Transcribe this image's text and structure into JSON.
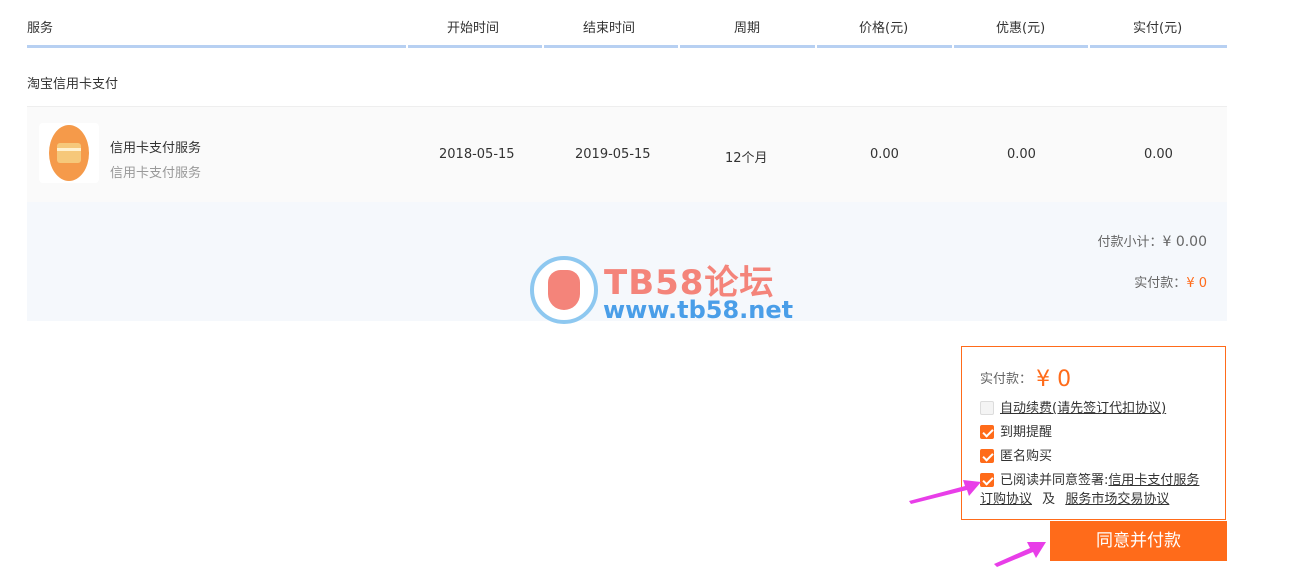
{
  "table": {
    "headers": {
      "service": "服务",
      "start": "开始时间",
      "end": "结束时间",
      "period": "周期",
      "price": "价格(元)",
      "discount": "优惠(元)",
      "paid": "实付(元)"
    },
    "section_title": "淘宝信用卡支付",
    "row": {
      "name": "信用卡支付服务",
      "subtitle": "信用卡支付服务",
      "start": "2018-05-15",
      "end": "2019-05-15",
      "period": "12个月",
      "price": "0.00",
      "discount": "0.00",
      "paid": "0.00"
    }
  },
  "summary": {
    "subtotal_label": "付款小计：",
    "subtotal_value": "¥ 0.00",
    "paid_label": "实付款：",
    "paid_value": "¥ 0"
  },
  "watermark": {
    "title": "TB58论坛",
    "url": "www.tb58.net"
  },
  "payment": {
    "total_label": "实付款：",
    "total_value": "¥ 0",
    "options": {
      "auto_renew": "自动续费(请先签订代扣协议)",
      "expiry_reminder": "到期提醒",
      "anonymous": "匿名购买",
      "agree_prefix": "已阅读并同意签署:",
      "agreement1_part1": "信用卡支付服务",
      "agreement1_part2": "订购协议",
      "and_text": "及",
      "agreement2": "服务市场交易协议"
    },
    "checked": {
      "auto_renew": false,
      "expiry_reminder": true,
      "anonymous": true,
      "agree": true
    },
    "button_label": "同意并付款"
  },
  "colors": {
    "accent": "#ff6b1a",
    "header_line": "#b7d0f2",
    "summary_bg": "#f5f8fc",
    "arrow": "#e83ee8"
  }
}
